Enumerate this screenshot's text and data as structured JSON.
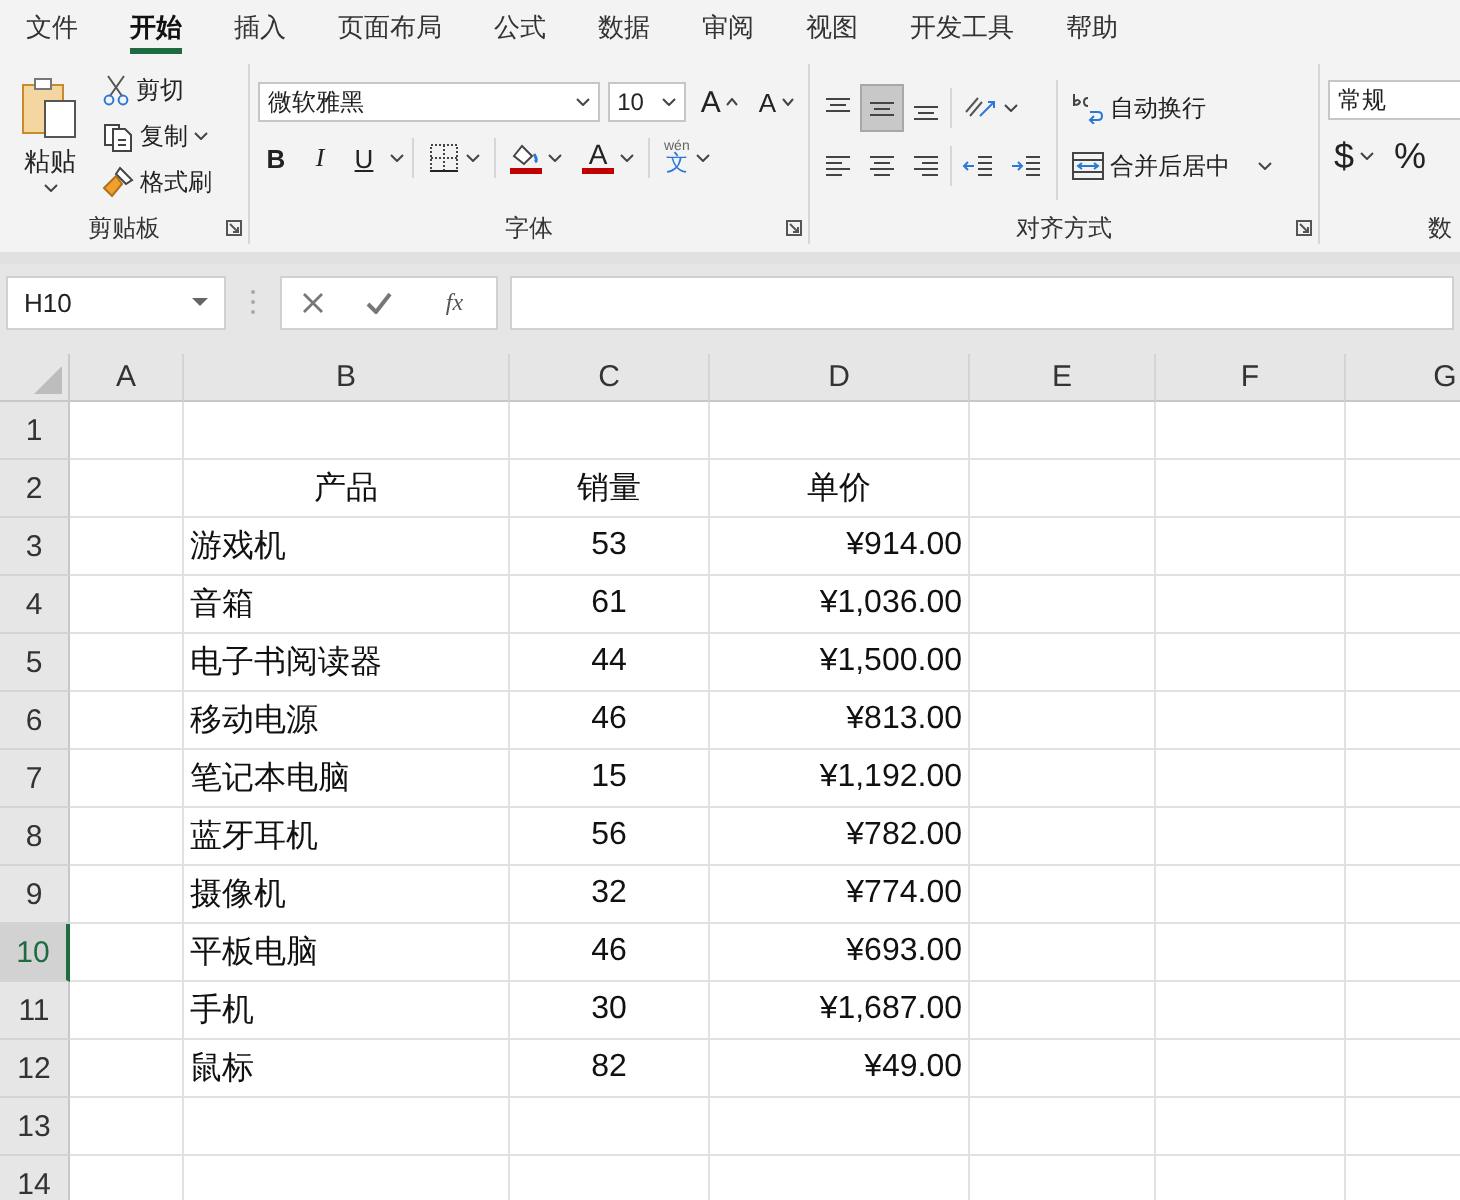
{
  "tabs": [
    {
      "label": "文件",
      "selected": false
    },
    {
      "label": "开始",
      "selected": true
    },
    {
      "label": "插入",
      "selected": false
    },
    {
      "label": "页面布局",
      "selected": false
    },
    {
      "label": "公式",
      "selected": false
    },
    {
      "label": "数据",
      "selected": false
    },
    {
      "label": "审阅",
      "selected": false
    },
    {
      "label": "视图",
      "selected": false
    },
    {
      "label": "开发工具",
      "selected": false
    },
    {
      "label": "帮助",
      "selected": false
    }
  ],
  "clipboard": {
    "paste": "粘贴",
    "cut": "剪切",
    "copy": "复制",
    "format_painter": "格式刷",
    "label": "剪贴板"
  },
  "font": {
    "font_name": "微软雅黑",
    "font_size": "10",
    "grow": "A",
    "shrink": "A",
    "bold": "B",
    "italic": "I",
    "underline": "U",
    "font_color": "A",
    "phonetic_top": "wén",
    "phonetic_bottom": "文",
    "label": "字体"
  },
  "alignment": {
    "buttons": [
      {
        "kind": "top",
        "selected": false
      },
      {
        "kind": "middle",
        "selected": true
      },
      {
        "kind": "bottom",
        "selected": false
      },
      {
        "kind": "left",
        "selected": false
      },
      {
        "kind": "center",
        "selected": false
      },
      {
        "kind": "right",
        "selected": false
      }
    ],
    "wrap_text": "自动换行",
    "merge_center": "合并后居中",
    "label": "对齐方式"
  },
  "number": {
    "format": "常规",
    "currency": "$",
    "percent": "%",
    "label": "数"
  },
  "formula_bar": {
    "name_box": "H10",
    "function_label": "fx"
  },
  "columns": [
    "A",
    "B",
    "C",
    "D",
    "E",
    "F",
    "G"
  ],
  "rows": [
    {
      "number": "1",
      "selected": false,
      "kind": "blank"
    },
    {
      "number": "2",
      "selected": false,
      "kind": "header",
      "product": "产品",
      "sales": "销量",
      "price": "单价"
    },
    {
      "number": "3",
      "selected": false,
      "kind": "data",
      "product": "游戏机",
      "sales": "53",
      "price": "¥914.00"
    },
    {
      "number": "4",
      "selected": false,
      "kind": "data",
      "product": "音箱",
      "sales": "61",
      "price": "¥1,036.00"
    },
    {
      "number": "5",
      "selected": false,
      "kind": "data",
      "product": "电子书阅读器",
      "sales": "44",
      "price": "¥1,500.00"
    },
    {
      "number": "6",
      "selected": false,
      "kind": "data",
      "product": "移动电源",
      "sales": "46",
      "price": "¥813.00"
    },
    {
      "number": "7",
      "selected": false,
      "kind": "data",
      "product": "笔记本电脑",
      "sales": "15",
      "price": "¥1,192.00"
    },
    {
      "number": "8",
      "selected": false,
      "kind": "data",
      "product": "蓝牙耳机",
      "sales": "56",
      "price": "¥782.00"
    },
    {
      "number": "9",
      "selected": false,
      "kind": "data",
      "product": "摄像机",
      "sales": "32",
      "price": "¥774.00"
    },
    {
      "number": "10",
      "selected": true,
      "kind": "data",
      "product": "平板电脑",
      "sales": "46",
      "price": "¥693.00"
    },
    {
      "number": "11",
      "selected": false,
      "kind": "data",
      "product": "手机",
      "sales": "30",
      "price": "¥1,687.00"
    },
    {
      "number": "12",
      "selected": false,
      "kind": "data",
      "product": "鼠标",
      "sales": "82",
      "price": "¥49.00"
    },
    {
      "number": "13",
      "selected": false,
      "kind": "blank"
    },
    {
      "number": "14",
      "selected": false,
      "kind": "blank"
    }
  ]
}
